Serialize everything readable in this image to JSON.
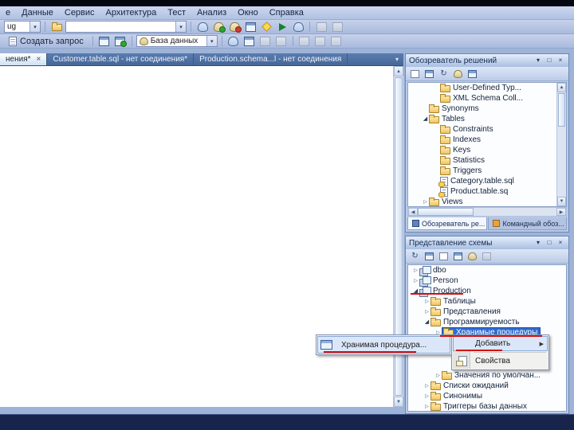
{
  "colors": {
    "selection_blue": "#2f6cd1",
    "annotation_red": "#d40f0f",
    "statusbar_navy": "#17254c",
    "tabbar_blue": "#5a7cb0"
  },
  "glyphs": {
    "chevron_down": "▾",
    "pin": "□",
    "close": "×",
    "tab_close": "×",
    "doc_list_chevron": "▾",
    "scroll_up": "▲",
    "scroll_down": "▼",
    "scroll_left": "◀",
    "scroll_right": "▶",
    "collapsed_arrow": "▷",
    "expanded_arrow": "◢",
    "submenu_arrow": "▶",
    "refresh": "↻"
  },
  "menubar": {
    "items": [
      "е",
      "Данные",
      "Сервис",
      "Архитектура",
      "Тест",
      "Анализ",
      "Окно",
      "Справка"
    ]
  },
  "toolbars": {
    "debug_combo_value": "ug",
    "connection_combo_value": "",
    "new_query_label": "Создать запрос",
    "database_combo_value": "База данных"
  },
  "document_tabs": {
    "tabs": [
      {
        "label": "нения*",
        "active": true
      },
      {
        "label": "Customer.table.sql - нет соединения*",
        "active": false
      },
      {
        "label": "Production.schema...l - нет соединения",
        "active": false
      }
    ]
  },
  "solution_explorer": {
    "title": "Обозреватель решений",
    "tree": [
      {
        "label": "User-Defined Typ...",
        "type": "folder"
      },
      {
        "label": "XML Schema Coll...",
        "type": "folder"
      },
      {
        "label": "Synonyms",
        "type": "folder"
      },
      {
        "label": "Tables",
        "type": "folder",
        "expanded": true
      },
      {
        "label": "Constraints",
        "type": "folder"
      },
      {
        "label": "Indexes",
        "type": "folder"
      },
      {
        "label": "Keys",
        "type": "folder"
      },
      {
        "label": "Statistics",
        "type": "folder"
      },
      {
        "label": "Triggers",
        "type": "folder"
      },
      {
        "label": "Category.table.sql",
        "type": "file"
      },
      {
        "label": "Product.table.sq",
        "type": "file"
      },
      {
        "label": "Views",
        "type": "folder",
        "expanded": false
      }
    ],
    "bottom_tabs": [
      {
        "label": "Обозреватель ре...",
        "active": true
      },
      {
        "label": "Командный обоз...",
        "active": false
      }
    ]
  },
  "schema_view": {
    "title": "Представление схемы",
    "tree": [
      {
        "label": "dbo",
        "type": "schema"
      },
      {
        "label": "Person",
        "type": "schema"
      },
      {
        "label": "Production",
        "type": "schema",
        "expanded": true
      },
      {
        "label": "Таблицы",
        "type": "folder"
      },
      {
        "label": "Представления",
        "type": "folder"
      },
      {
        "label": "Программируемость",
        "type": "folder",
        "expanded": true
      },
      {
        "label": "Хранимые процедуры",
        "type": "folder",
        "selected": true
      },
      {
        "label": "Значения по умолчан...",
        "type": "folder"
      },
      {
        "label": "Списки ожиданий",
        "type": "folder"
      },
      {
        "label": "Синонимы",
        "type": "folder"
      },
      {
        "label": "Триггеры базы данных",
        "type": "folder"
      }
    ]
  },
  "context_menu": {
    "items": [
      {
        "label": "Добавить",
        "has_submenu": true
      },
      {
        "label": "Свойства",
        "has_submenu": false
      }
    ]
  },
  "add_submenu": {
    "items": [
      {
        "label": "Хранимая процедура..."
      }
    ]
  },
  "status_bar": {
    "text": ""
  }
}
